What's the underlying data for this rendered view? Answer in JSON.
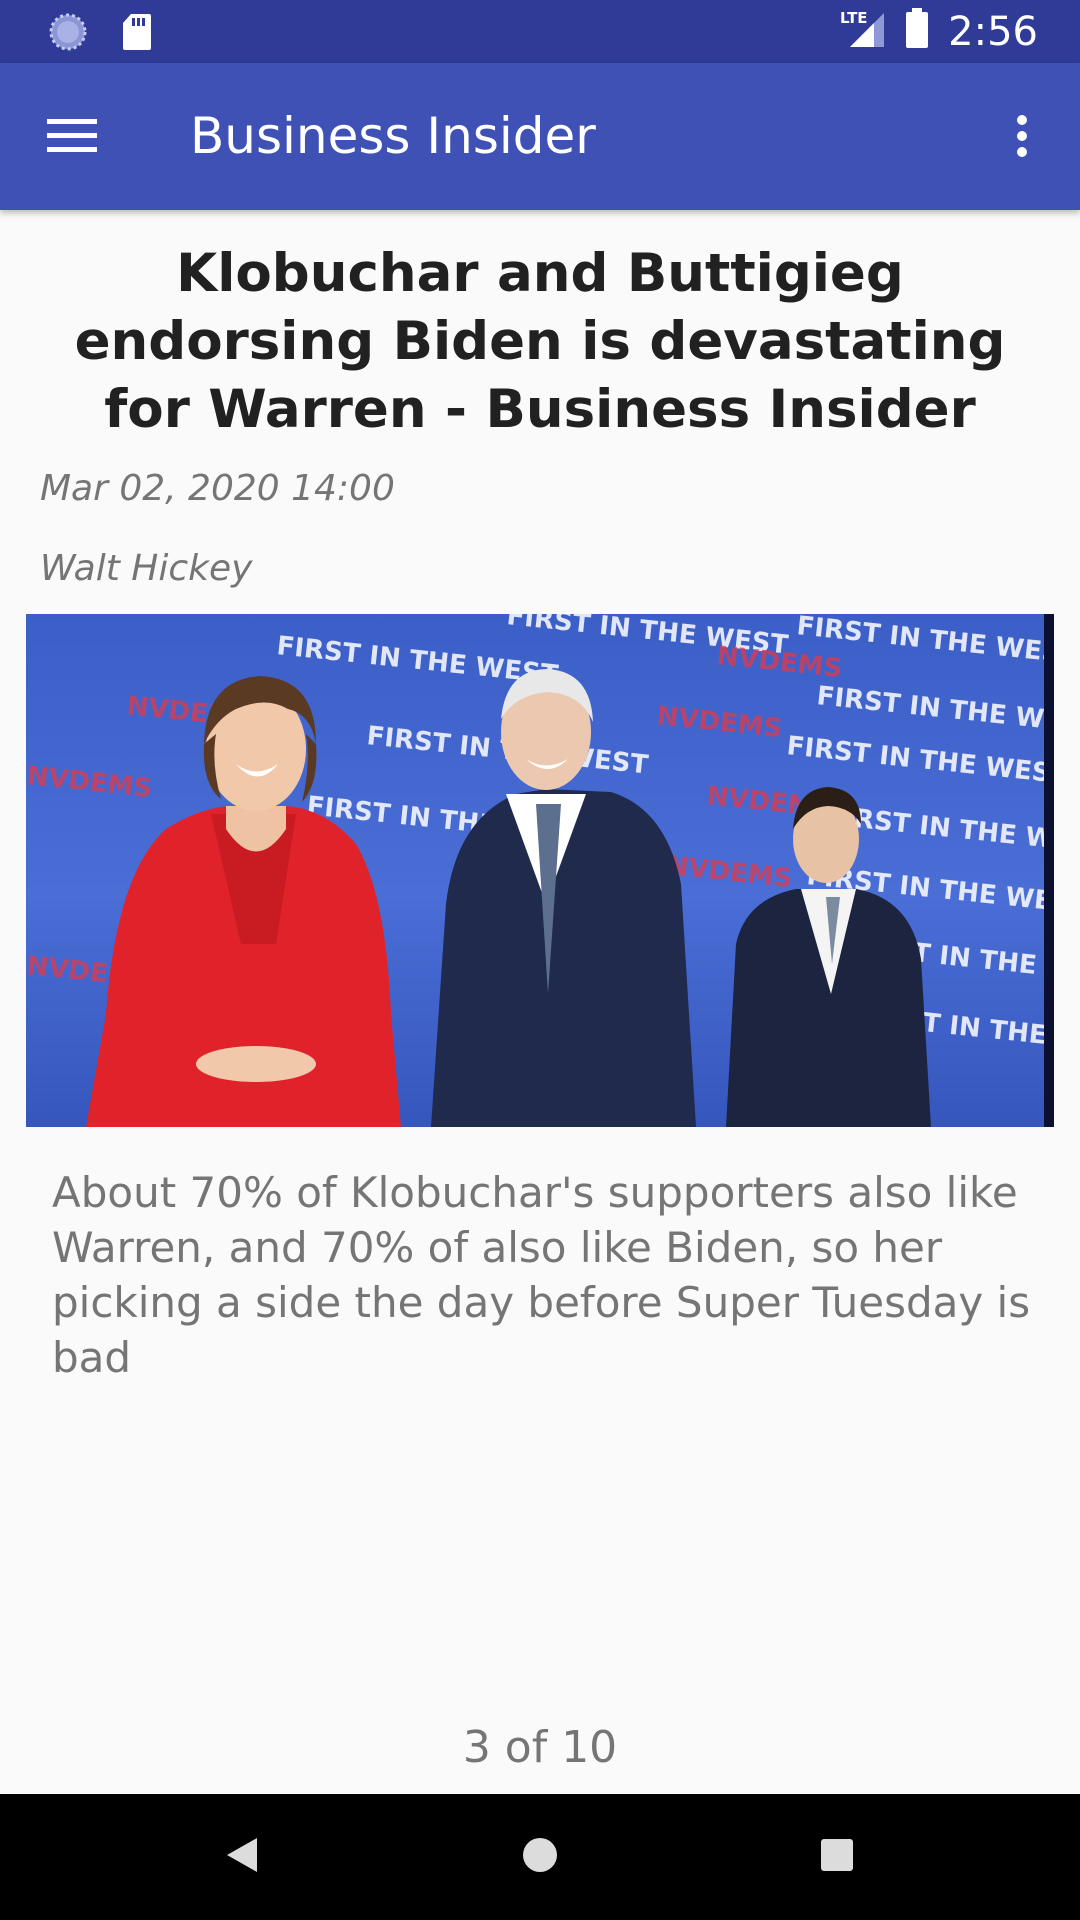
{
  "status_bar": {
    "time": "2:56",
    "network": "LTE",
    "icons": [
      "sync-icon",
      "sd-card-icon",
      "signal-icon",
      "battery-icon"
    ]
  },
  "app_bar": {
    "title": "Business Insider",
    "menu_icon": "hamburger-menu-icon",
    "overflow_icon": "more-vert-icon"
  },
  "article": {
    "headline": "Klobuchar and Buttigieg endorsing Biden is devastating for Warren - Business Insider",
    "date": "Mar 02, 2020 14:00",
    "author": "Walt Hickey",
    "summary": "About 70% of Klobuchar's supporters also like Warren, and 70% of also like Biden, so her picking a side the day before Super Tuesday is bad",
    "image_backdrop_text": [
      "FIRST IN THE WEST",
      "NVDEMS"
    ]
  },
  "pager": {
    "text": "3 of 10"
  },
  "nav_bar": {
    "icons": [
      "back-icon",
      "home-icon",
      "recents-icon"
    ]
  },
  "colors": {
    "status_bar": "#2f3b97",
    "app_bar": "#3f51b5",
    "background": "#fafafa",
    "headline": "#212121",
    "secondary_text": "#757575"
  }
}
